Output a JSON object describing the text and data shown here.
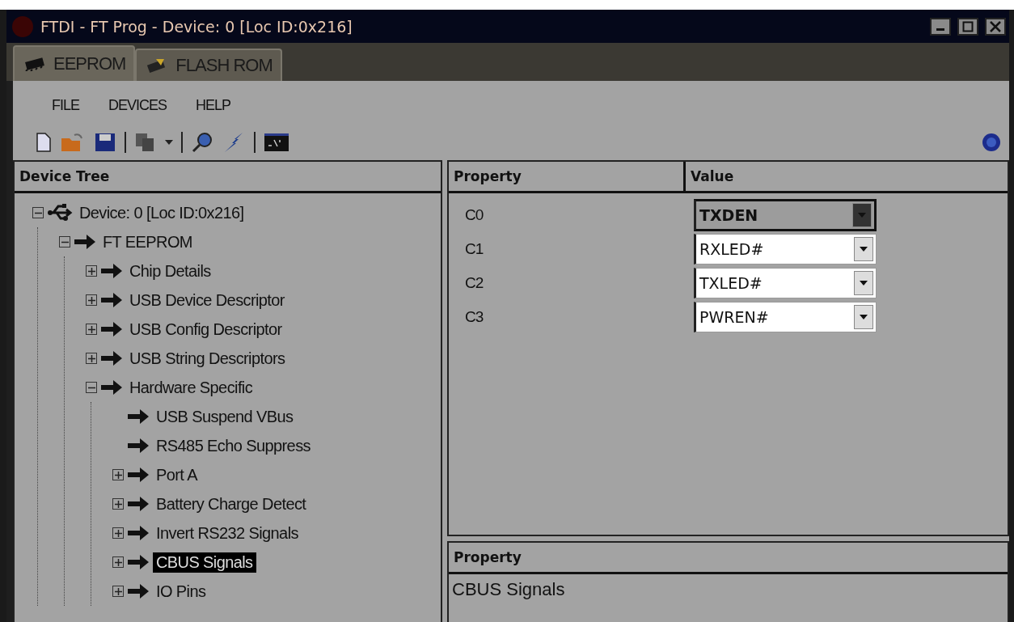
{
  "window": {
    "title": "FTDI - FT Prog - Device: 0 [Loc ID:0x216]"
  },
  "tabs": [
    {
      "label": "EEPROM",
      "selected": true,
      "kind": "chip"
    },
    {
      "label": "FLASH ROM",
      "selected": false,
      "kind": "flash"
    }
  ],
  "menu": [
    "FILE",
    "DEVICES",
    "HELP"
  ],
  "device_tree": {
    "header": "Device Tree",
    "items": [
      {
        "label": "Device: 0 [Loc ID:0x216]",
        "kind": "device",
        "expanded": true,
        "selected": false,
        "children": [
          {
            "label": "FT EEPROM",
            "kind": "node",
            "expanded": true,
            "selected": false,
            "children": [
              {
                "label": "Chip Details",
                "kind": "node",
                "expanded": false,
                "selected": false
              },
              {
                "label": "USB Device Descriptor",
                "kind": "node",
                "expanded": false,
                "selected": false
              },
              {
                "label": "USB Config Descriptor",
                "kind": "node",
                "expanded": false,
                "selected": false
              },
              {
                "label": "USB String Descriptors",
                "kind": "node",
                "expanded": false,
                "selected": false
              },
              {
                "label": "Hardware Specific",
                "kind": "node",
                "expanded": true,
                "selected": false,
                "children": [
                  {
                    "label": "USB Suspend VBus",
                    "kind": "leaf",
                    "selected": false
                  },
                  {
                    "label": "RS485 Echo Suppress",
                    "kind": "leaf",
                    "selected": false
                  },
                  {
                    "label": "Port A",
                    "kind": "node",
                    "expanded": false,
                    "selected": false
                  },
                  {
                    "label": "Battery Charge Detect",
                    "kind": "node",
                    "expanded": false,
                    "selected": false
                  },
                  {
                    "label": "Invert RS232 Signals",
                    "kind": "node",
                    "expanded": false,
                    "selected": false
                  },
                  {
                    "label": "CBUS Signals",
                    "kind": "node",
                    "expanded": false,
                    "selected": true
                  },
                  {
                    "label": "IO Pins",
                    "kind": "node",
                    "expanded": false,
                    "selected": false
                  }
                ]
              }
            ]
          }
        ]
      }
    ]
  },
  "property_grid": {
    "columns": [
      "Property",
      "Value"
    ],
    "rows": [
      {
        "name": "C0",
        "value": "TXDEN",
        "selected": true
      },
      {
        "name": "C1",
        "value": "RXLED#",
        "selected": false
      },
      {
        "name": "C2",
        "value": "TXLED#",
        "selected": false
      },
      {
        "name": "C3",
        "value": "PWREN#",
        "selected": false
      }
    ]
  },
  "description": {
    "header": "Property",
    "text": "CBUS Signals"
  }
}
